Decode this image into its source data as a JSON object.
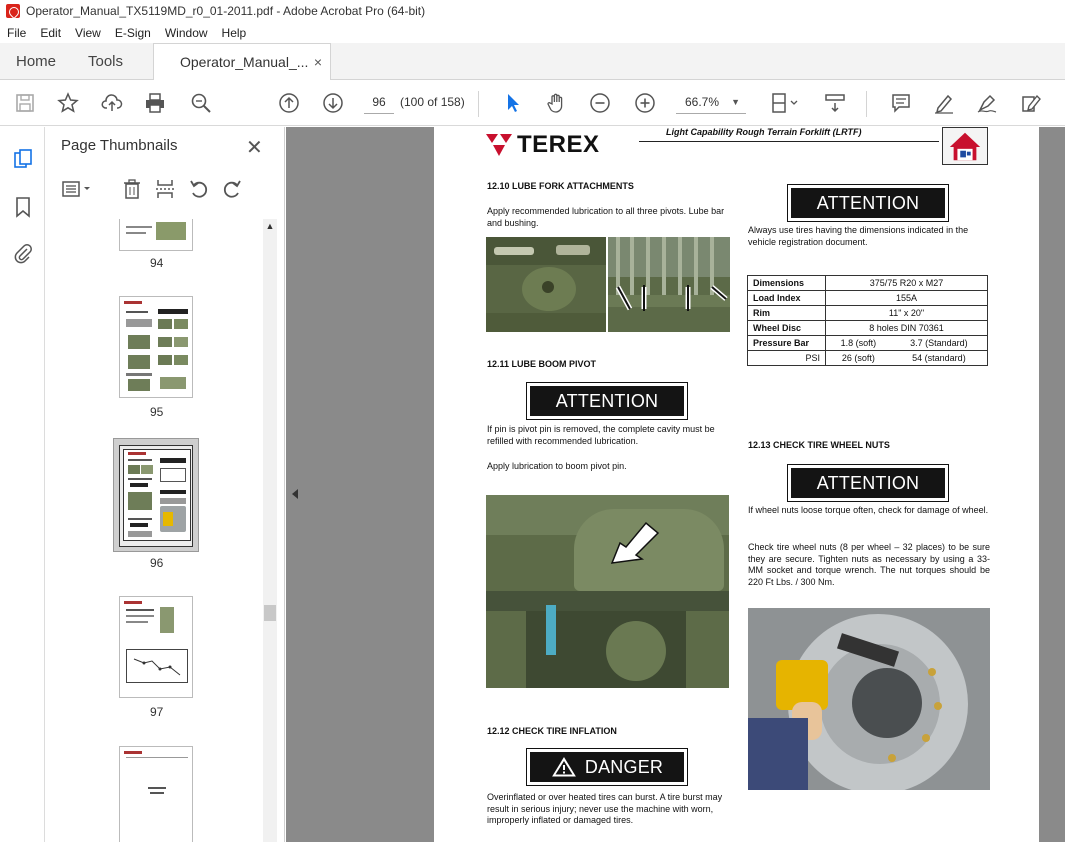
{
  "window": {
    "title": "Operator_Manual_TX5119MD_r0_01-2011.pdf - Adobe Acrobat Pro (64-bit)"
  },
  "menu": [
    "File",
    "Edit",
    "View",
    "E-Sign",
    "Window",
    "Help"
  ],
  "tabs": {
    "home": "Home",
    "tools": "Tools",
    "document": "Operator_Manual_...",
    "close": "×"
  },
  "toolbar": {
    "page_current": "96",
    "page_count": "(100 of 158)",
    "zoom": "66.7%"
  },
  "panel": {
    "title": "Page Thumbnails",
    "close": "✕",
    "thumbnails": [
      {
        "label": "94"
      },
      {
        "label": "95"
      },
      {
        "label": "96",
        "selected": true
      },
      {
        "label": "97"
      },
      {
        "label": ""
      }
    ]
  },
  "page": {
    "brand": "TEREX",
    "header_title": "Light Capability Rough Terrain Forklift (LRTF)",
    "s1210": {
      "heading": "12.10 LUBE FORK ATTACHMENTS",
      "body": "Apply recommended lubrication to all three pivots. Lube bar and bushing."
    },
    "s1211": {
      "heading": "12.11 LUBE BOOM PIVOT",
      "badge": "ATTENTION",
      "body1": "If pin is pivot pin is removed, the complete cavity must be refilled with recommended lubrication.",
      "body2": "Apply lubrication to boom pivot pin."
    },
    "s1212": {
      "heading": "12.12 CHECK TIRE INFLATION",
      "badge": "DANGER",
      "body": "Overinflated or over heated tires can burst. A tire burst may result in serious injury; never use the machine with worn, improperly inflated or damaged tires."
    },
    "right_attention": {
      "badge": "ATTENTION",
      "body": "Always use tires having the dimensions indicated in the vehicle registration document."
    },
    "tire_table": {
      "dimensions_k": "Dimensions",
      "dimensions_v": "375/75 R20 x M27",
      "load_k": "Load Index",
      "load_v": "155A",
      "rim_k": "Rim",
      "rim_v": "11\" x 20\"",
      "disc_k": "Wheel Disc",
      "disc_v": "8 holes DIN 70361",
      "pbar_k": "Pressure Bar",
      "pbar_soft": "1.8 (soft)",
      "pbar_std": "3.7 (Standard)",
      "psi_k": "PSI",
      "psi_soft": "26 (soft)",
      "psi_std": "54 (standard)"
    },
    "s1213": {
      "heading": "12.13 CHECK TIRE WHEEL NUTS",
      "badge": "ATTENTION",
      "body1": "If wheel nuts loose torque often, check for damage of wheel.",
      "body2": "Check tire wheel nuts (8 per wheel – 32 places) to be sure they are secure. Tighten nuts as necessary by using a 33-MM socket and torque wrench. The nut torques should be 220 Ft Lbs. / 300 Nm."
    }
  }
}
